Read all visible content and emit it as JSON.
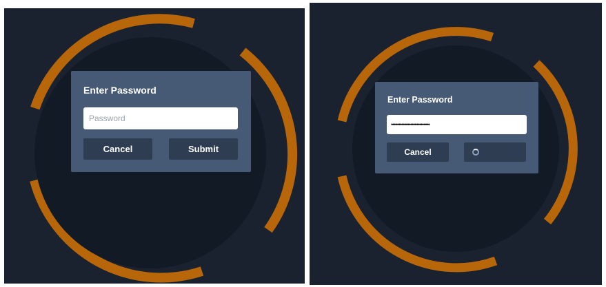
{
  "colors": {
    "background": "#1a2230",
    "ring_accent": "#b8660a",
    "inner_circle": "#121a25",
    "dialog": "#465a76",
    "button": "#2f3d52"
  },
  "states": [
    {
      "state": "empty",
      "dialog": {
        "title": "Enter Password",
        "password_placeholder": "Password",
        "password_value": "",
        "cancel_label": "Cancel",
        "submit_label": "Submit"
      }
    },
    {
      "state": "submitting",
      "dialog": {
        "title": "Enter Password",
        "password_placeholder": "",
        "password_value": "••••••••••••••••••••••••••",
        "cancel_label": "Cancel",
        "submit_icon": "loading-spinner-icon"
      }
    }
  ]
}
